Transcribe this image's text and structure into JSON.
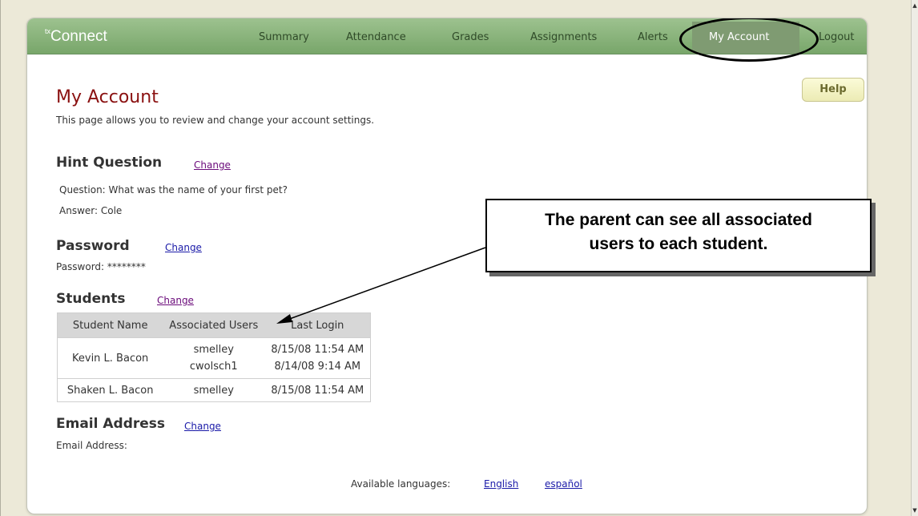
{
  "nav": {
    "logo_prefix": "tx",
    "logo": "Connect",
    "items": [
      {
        "label": "Summary"
      },
      {
        "label": "Attendance"
      },
      {
        "label": "Grades"
      },
      {
        "label": "Assignments"
      },
      {
        "label": "Alerts"
      },
      {
        "label": "My Account"
      },
      {
        "label": "Logout"
      }
    ]
  },
  "help_label": "Help",
  "page": {
    "title": "My Account",
    "description": "This page allows you to review and change your account settings."
  },
  "hint": {
    "title": "Hint Question",
    "change": "Change",
    "question": "Question: What was the name of your first pet?",
    "answer": "Answer:  Cole"
  },
  "password": {
    "title": "Password",
    "change": "Change",
    "value": "Password: ********"
  },
  "students": {
    "title": "Students",
    "change": "Change",
    "headers": [
      "Student Name",
      "Associated Users",
      "Last Login"
    ],
    "rows": [
      {
        "name": "Kevin L. Bacon",
        "users": [
          "smelley",
          "cwolsch1"
        ],
        "logins": [
          "8/15/08 11:54 AM",
          "8/14/08 9:14 AM"
        ]
      },
      {
        "name": "Shaken L. Bacon",
        "users": [
          "smelley"
        ],
        "logins": [
          "8/15/08 11:54 AM"
        ]
      }
    ]
  },
  "email": {
    "title": "Email Address",
    "change": "Change",
    "label": "Email Address:"
  },
  "languages": {
    "label": "Available languages:",
    "english": "English",
    "spanish": "español"
  },
  "callout": {
    "line1": "The parent can see all associated",
    "line2": "users to each student."
  }
}
